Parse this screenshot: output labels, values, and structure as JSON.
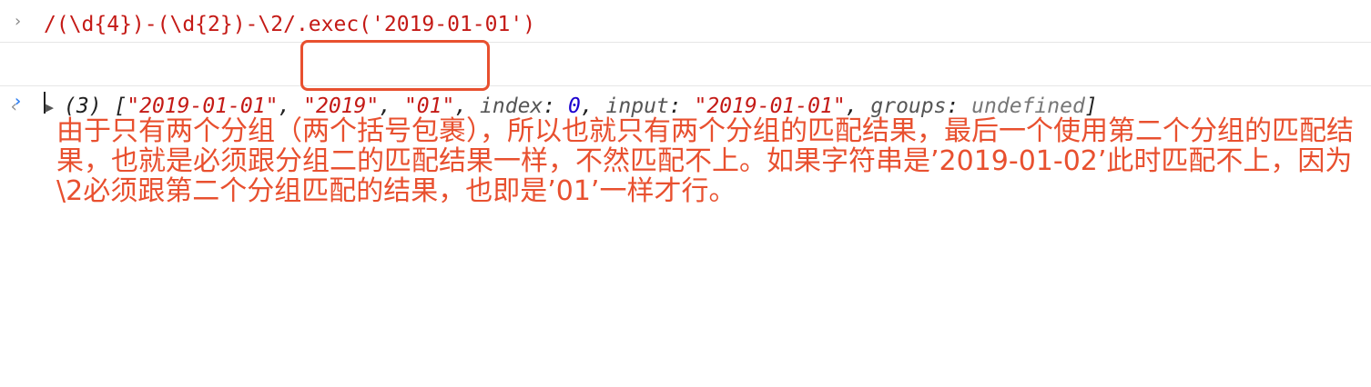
{
  "console": {
    "input_prompt": "›",
    "input_expression": "/(\\d{4})-(\\d{2})-\\2/.exec('2019-01-01')",
    "output_arrow": "‹",
    "output": {
      "count": "(3)",
      "open_bracket": "[",
      "item0": "\"2019-01-01\"",
      "item1": "\"2019\"",
      "item2": "\"01\"",
      "index_key": "index",
      "index_value": "0",
      "input_key": "input",
      "input_value": "\"2019-01-01\"",
      "groups_key": "groups",
      "groups_value": "undefined",
      "close_bracket": "]"
    },
    "active_prompt": "›"
  },
  "annotation": {
    "text": "由于只有两个分组（两个括号包裹），所以也就只有两个分组的匹配结果，最后一个使用第二个分组的匹配结果，也就是必须跟分组二的匹配结果一样，不然匹配不上。如果字符串是’2019-01-02’此时匹配不上，因为\\2必须跟第二个分组匹配的结果，也即是’01’一样才行。"
  },
  "colors": {
    "annotation": "#e8502f",
    "string": "#c41a16",
    "number": "#1c00cf",
    "prompt_active": "#2f7ff1"
  }
}
